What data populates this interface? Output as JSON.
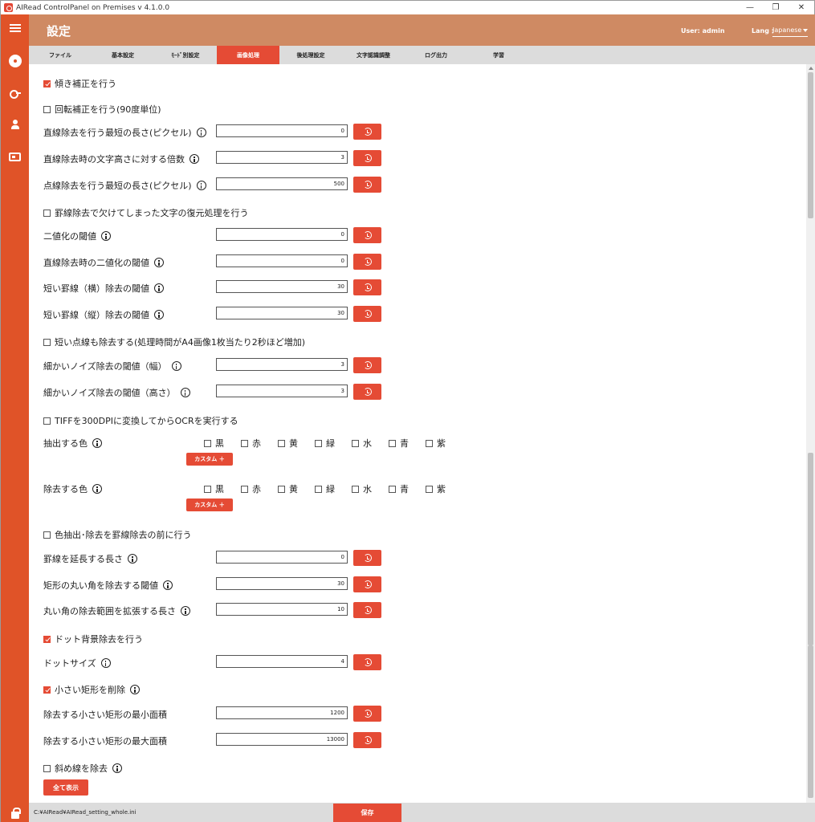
{
  "window": {
    "title": "AIRead ControlPanel on Premises v 4.1.0.0"
  },
  "header": {
    "title": "設定",
    "user": "User: admin",
    "lang_label": "Lang :",
    "lang_value": "Japanese"
  },
  "tabs": [
    {
      "label": "ファイル"
    },
    {
      "label": "基本設定"
    },
    {
      "label": "ﾓｰﾄﾞ別設定"
    },
    {
      "label": "画像処理"
    },
    {
      "label": "後処理設定"
    },
    {
      "label": "文字認識調整"
    },
    {
      "label": "ログ出力"
    },
    {
      "label": "学習"
    }
  ],
  "active_tab": "画像処理",
  "settings": {
    "deskew": {
      "label": "傾き補正を行う",
      "checked": true
    },
    "rotate": {
      "label": "回転補正を行う(90度単位)",
      "checked": false
    },
    "line_min_len": {
      "label": "直線除去を行う最短の長さ(ピクセル)",
      "value": "0"
    },
    "line_char_ratio": {
      "label": "直線除去時の文字高さに対する倍数",
      "value": "3"
    },
    "dotline_min_len": {
      "label": "点線除去を行う最短の長さ(ピクセル)",
      "value": "500"
    },
    "restore_chars": {
      "label": "罫線除去で欠けてしまった文字の復元処理を行う",
      "checked": false
    },
    "binarize_th": {
      "label": "二値化の閾値",
      "value": "0"
    },
    "line_binarize_th": {
      "label": "直線除去時の二値化の閾値",
      "value": "0"
    },
    "short_h_th": {
      "label": "短い罫線（横）除去の閾値",
      "value": "30"
    },
    "short_v_th": {
      "label": "短い罫線（縦）除去の閾値",
      "value": "30"
    },
    "short_dots": {
      "label": "短い点線も除去する(処理時間がA4画像1枚当たり2秒ほど増加)",
      "checked": false
    },
    "noise_w": {
      "label": "細かいノイズ除去の閾値（幅）",
      "value": "3"
    },
    "noise_h": {
      "label": "細かいノイズ除去の閾値（高さ）",
      "value": "3"
    },
    "tiff300": {
      "label": "TIFFを300DPIに変換してからOCRを実行する",
      "checked": false
    },
    "extract_color": {
      "label": "抽出する色"
    },
    "remove_color": {
      "label": "除去する色"
    },
    "custom_label": "カスタム ＋",
    "color_before": {
      "label": "色抽出･除去を罫線除去の前に行う",
      "checked": false
    },
    "extend_len": {
      "label": "罫線を延長する長さ",
      "value": "0"
    },
    "round_corner_th": {
      "label": "矩形の丸い角を除去する閾値",
      "value": "30"
    },
    "round_extend_len": {
      "label": "丸い角の除去範囲を拡張する長さ",
      "value": "10"
    },
    "dot_bg": {
      "label": "ドット背景除去を行う",
      "checked": true
    },
    "dot_size": {
      "label": "ドットサイズ",
      "value": "4"
    },
    "small_rect": {
      "label": "小さい矩形を削除",
      "checked": true
    },
    "small_rect_min": {
      "label": "除去する小さい矩形の最小面積",
      "value": "1200"
    },
    "small_rect_max": {
      "label": "除去する小さい矩形の最大面積",
      "value": "13000"
    },
    "diag_line": {
      "label": "斜め線を除去",
      "checked": false
    }
  },
  "colors": [
    "黒",
    "赤",
    "黄",
    "緑",
    "水",
    "青",
    "紫"
  ],
  "show_all_label": "全て表示",
  "footer": {
    "path": "C:¥AIRead¥AIRead_setting_whole.ini",
    "save_label": "保存"
  },
  "theme": {
    "accent": "#e54b35",
    "sidebar": "#e05328",
    "header": "#cf8a63"
  }
}
